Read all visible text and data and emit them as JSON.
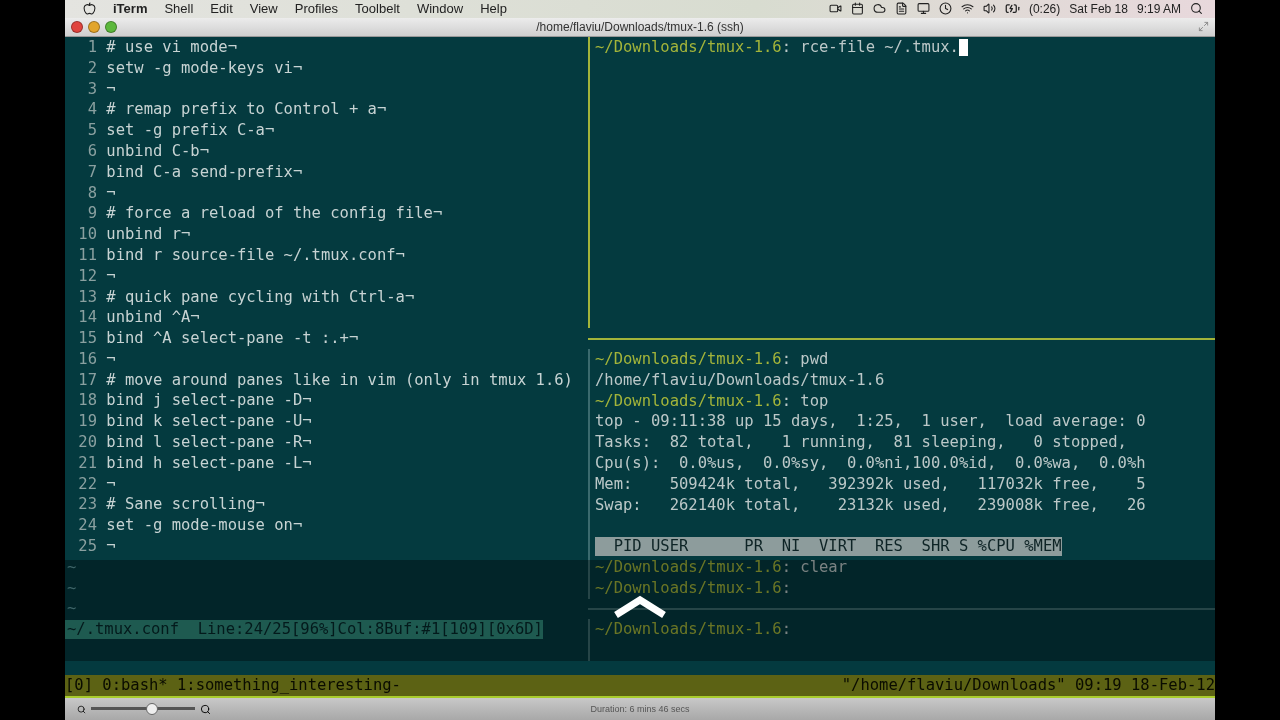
{
  "menu_bar": {
    "app": "iTerm",
    "items": [
      "Shell",
      "Edit",
      "View",
      "Profiles",
      "Toolbelt",
      "Window",
      "Help"
    ],
    "battery": "(0:26)",
    "date": "Sat Feb 18",
    "time": "9:19 AM"
  },
  "window": {
    "title": "/home/flaviu/Downloads/tmux-1.6 (ssh)"
  },
  "editor": {
    "lines": [
      {
        "number": "1",
        "text": "# use vi mode¬"
      },
      {
        "number": "2",
        "text": "setw -g mode-keys vi¬"
      },
      {
        "number": "3",
        "text": "¬"
      },
      {
        "number": "4",
        "text": "# remap prefix to Control + a¬"
      },
      {
        "number": "5",
        "text": "set -g prefix C-a¬"
      },
      {
        "number": "6",
        "text": "unbind C-b¬"
      },
      {
        "number": "7",
        "text": "bind C-a send-prefix¬"
      },
      {
        "number": "8",
        "text": "¬"
      },
      {
        "number": "9",
        "text": "# force a reload of the config file¬"
      },
      {
        "number": "10",
        "text": "unbind r¬"
      },
      {
        "number": "11",
        "text": "bind r source-file ~/.tmux.conf¬"
      },
      {
        "number": "12",
        "text": "¬"
      },
      {
        "number": "13",
        "text": "# quick pane cycling with Ctrl-a¬"
      },
      {
        "number": "14",
        "text": "unbind ^A¬"
      },
      {
        "number": "15",
        "text": "bind ^A select-pane -t :.+¬"
      },
      {
        "number": "16",
        "text": "¬"
      },
      {
        "number": "17",
        "text": "# move around panes like in vim (only in tmux 1.6)"
      },
      {
        "number": "18",
        "text": "bind j select-pane -D¬"
      },
      {
        "number": "19",
        "text": "bind k select-pane -U¬"
      },
      {
        "number": "20",
        "text": "bind l select-pane -R¬"
      },
      {
        "number": "21",
        "text": "bind h select-pane -L¬"
      },
      {
        "number": "22",
        "text": "¬"
      },
      {
        "number": "23",
        "text": "# Sane scrolling¬"
      },
      {
        "number": "24",
        "text": "set -g mode-mouse on¬"
      },
      {
        "number": "25",
        "text": "¬"
      }
    ],
    "empty_markers": [
      "~",
      "~",
      "~"
    ],
    "status_line": "~/.tmux.conf  Line:24/25[96%]Col:8Buf:#1[109][0x6D]"
  },
  "top_pane": {
    "active": true,
    "lines": [
      {
        "kind": "prompt",
        "prompt": "~/Downloads/tmux-1.6",
        "command": ": rce-file ~/.tmux.",
        "cursor": true
      }
    ]
  },
  "bottom_pane": {
    "active": false,
    "lines": [
      {
        "kind": "prompt",
        "prompt": "~/Downloads/tmux-1.6",
        "command": ": pwd"
      },
      {
        "kind": "output",
        "text": "/home/flaviu/Downloads/tmux-1.6"
      },
      {
        "kind": "prompt",
        "prompt": "~/Downloads/tmux-1.6",
        "command": ": top"
      },
      {
        "kind": "output",
        "text": "top - 09:11:38 up 15 days,  1:25,  1 user,  load average: 0"
      },
      {
        "kind": "output",
        "text": "Tasks:  82 total,   1 running,  81 sleeping,   0 stopped,"
      },
      {
        "kind": "output",
        "text": "Cpu(s):  0.0%us,  0.0%sy,  0.0%ni,100.0%id,  0.0%wa,  0.0%h"
      },
      {
        "kind": "output",
        "text": "Mem:    509424k total,   392392k used,   117032k free,    5"
      },
      {
        "kind": "output",
        "text": "Swap:   262140k total,    23132k used,   239008k free,   26"
      },
      {
        "kind": "blank"
      },
      {
        "kind": "header",
        "text": "  PID USER      PR  NI  VIRT  RES  SHR S %CPU %MEM"
      },
      {
        "kind": "prompt",
        "prompt": "~/Downloads/tmux-1.6",
        "command": ": clear"
      },
      {
        "kind": "prompt",
        "prompt": "~/Downloads/tmux-1.6",
        "command": ":"
      }
    ]
  },
  "third_pane": {
    "active": false,
    "lines": [
      {
        "kind": "prompt",
        "prompt": "~/Downloads/tmux-1.6",
        "command": ":"
      }
    ]
  },
  "status_bar": {
    "left": "[0] 0:bash* 1:something_interesting-",
    "right": "\"/home/flaviu/Downloads\" 09:19 18-Feb-12"
  },
  "player": {
    "zoom": {
      "level": 0.58
    },
    "duration": "Duration: 6 mins 46 secs"
  }
}
